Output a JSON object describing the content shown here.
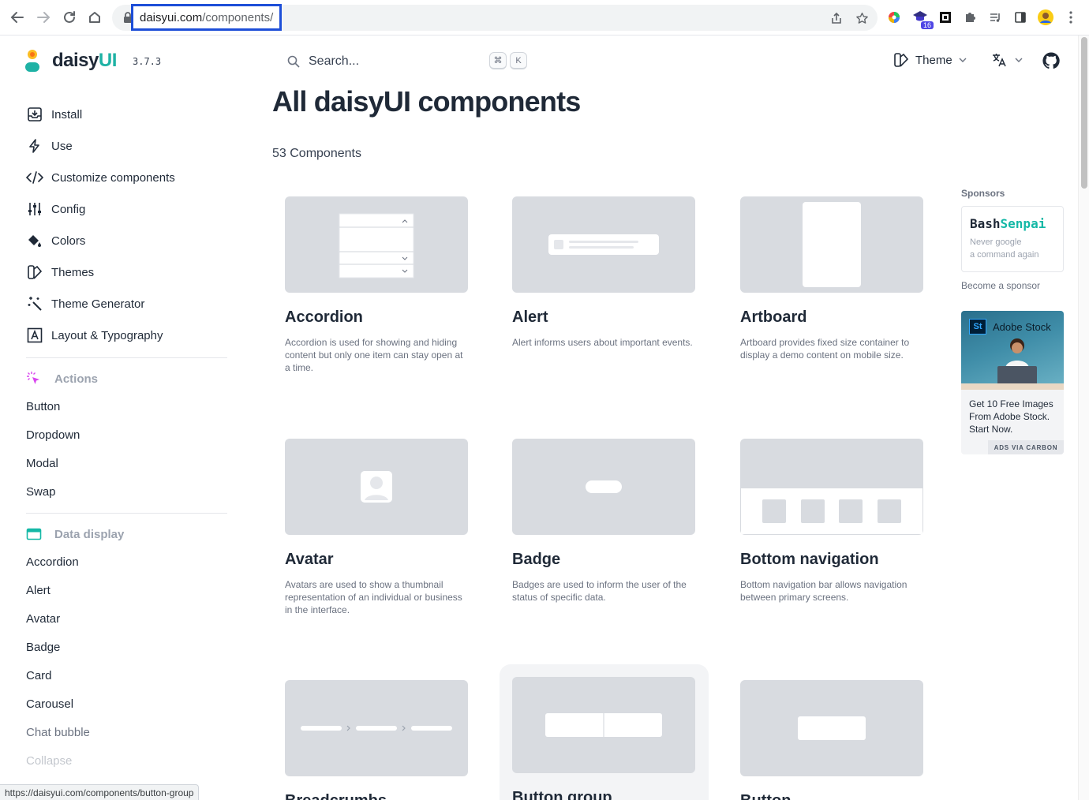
{
  "browser": {
    "url_domain": "daisyui.com",
    "url_path": "/components/",
    "ext_badge": "16",
    "status_url": "https://daisyui.com/components/button-group"
  },
  "sidebar": {
    "logo_plain": "daisy",
    "logo_accent": "UI",
    "version": "3.7.3",
    "items": [
      {
        "label": "Install",
        "icon": "inbox-download-icon"
      },
      {
        "label": "Use",
        "icon": "bolt-icon"
      },
      {
        "label": "Customize components",
        "icon": "code-icon"
      },
      {
        "label": "Config",
        "icon": "sliders-icon"
      },
      {
        "label": "Colors",
        "icon": "paint-bucket-icon"
      },
      {
        "label": "Themes",
        "icon": "swatch-icon"
      },
      {
        "label": "Theme Generator",
        "icon": "magic-wand-icon"
      },
      {
        "label": "Layout & Typography",
        "icon": "typography-icon"
      }
    ],
    "sections": [
      {
        "label": "Actions",
        "icon": "cursor-click-icon",
        "color": "#d946ef",
        "links": [
          "Button",
          "Dropdown",
          "Modal",
          "Swap"
        ]
      },
      {
        "label": "Data display",
        "icon": "window-icon",
        "color": "#14b8a6",
        "links": [
          "Accordion",
          "Alert",
          "Avatar",
          "Badge",
          "Card",
          "Carousel",
          "Chat bubble",
          "Collapse"
        ]
      }
    ]
  },
  "header": {
    "search_placeholder": "Search...",
    "kbd_cmd": "⌘",
    "kbd_k": "K",
    "theme_label": "Theme"
  },
  "main": {
    "title": "All daisyUI components",
    "count": "53 Components",
    "cards": [
      {
        "title": "Accordion",
        "desc": "Accordion is used for showing and hiding content but only one item can stay open at a time."
      },
      {
        "title": "Alert",
        "desc": "Alert informs users about important events."
      },
      {
        "title": "Artboard",
        "desc": "Artboard provides fixed size container to display a demo content on mobile size."
      },
      {
        "title": "Avatar",
        "desc": "Avatars are used to show a thumbnail representation of an individual or business in the interface."
      },
      {
        "title": "Badge",
        "desc": "Badges are used to inform the user of the status of specific data."
      },
      {
        "title": "Bottom navigation",
        "desc": "Bottom navigation bar allows navigation between primary screens."
      },
      {
        "title": "Breadcrumbs",
        "desc": ""
      },
      {
        "title": "Button group",
        "desc": ""
      },
      {
        "title": "Button",
        "desc": ""
      }
    ]
  },
  "sponsors": {
    "title": "Sponsors",
    "bash_plain": "Bash",
    "bash_accent": "Senpai",
    "bash_sub_1": "Never google",
    "bash_sub_2": "a command again",
    "become": "Become a sponsor",
    "ad_brand_mark": "St",
    "ad_brand": "Adobe Stock",
    "ad_text": "Get 10 Free Images From Adobe Stock. Start Now.",
    "ad_footer": "ADS VIA CARBON"
  }
}
